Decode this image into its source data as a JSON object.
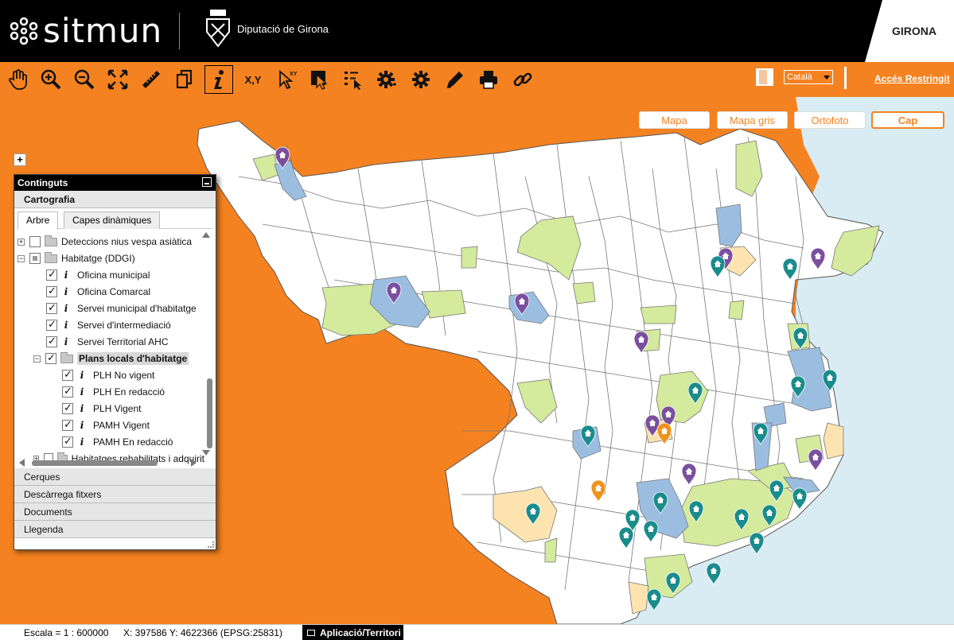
{
  "header": {
    "app_name": "sitmun",
    "org_name": "Diputació de Girona",
    "region": "GIRONA"
  },
  "toolbar": {
    "tools": [
      {
        "name": "pan-tool",
        "icon": "hand-icon"
      },
      {
        "name": "zoom-in-tool",
        "icon": "zoom-in-icon"
      },
      {
        "name": "zoom-out-tool",
        "icon": "zoom-out-icon"
      },
      {
        "name": "full-extent-tool",
        "icon": "expand-icon"
      },
      {
        "name": "measure-tool",
        "icon": "ruler-icon"
      },
      {
        "name": "copy-tool",
        "icon": "copy-icon"
      },
      {
        "name": "info-tool",
        "icon": "info-icon",
        "active": true
      },
      {
        "name": "xy-tool",
        "icon": "xy-icon",
        "label": "X,Y"
      },
      {
        "name": "locate-xy-tool",
        "icon": "cursor-xy-icon"
      },
      {
        "name": "select-tool",
        "icon": "select-icon"
      },
      {
        "name": "select-list-tool",
        "icon": "list-select-icon"
      },
      {
        "name": "settings-tool",
        "icon": "gear-icon"
      },
      {
        "name": "advanced-settings-tool",
        "icon": "gear-plus-icon"
      },
      {
        "name": "edit-tool",
        "icon": "pencil-icon"
      },
      {
        "name": "print-tool",
        "icon": "printer-icon"
      },
      {
        "name": "link-tool",
        "icon": "link-icon"
      }
    ],
    "language": "Català",
    "restricted_access": "Accés Restringit"
  },
  "base_layers": [
    {
      "label": "Mapa",
      "active": false
    },
    {
      "label": "Mapa gris",
      "active": false
    },
    {
      "label": "Ortofoto",
      "active": false
    },
    {
      "label": "Cap",
      "active": true
    }
  ],
  "zoom": {
    "plus": "+"
  },
  "panel": {
    "title": "Continguts",
    "section_cartography": "Cartografia",
    "tabs": [
      "Arbre",
      "Capes dinàmiques"
    ],
    "tree": [
      {
        "label": "Deteccions nius vespa asiàtica",
        "type": "folder",
        "level": 0,
        "expander": "+",
        "checked": false
      },
      {
        "label": "Habitatge (DDGI)",
        "type": "folder",
        "level": 0,
        "expander": "−",
        "checked": "partial"
      },
      {
        "label": "Oficina municipal",
        "type": "layer",
        "level": 1,
        "checked": true
      },
      {
        "label": "Oficina Comarcal",
        "type": "layer",
        "level": 1,
        "checked": true
      },
      {
        "label": "Servei municipal d'habitatge",
        "type": "layer",
        "level": 1,
        "checked": true
      },
      {
        "label": "Servei d'intermediació",
        "type": "layer",
        "level": 1,
        "checked": true
      },
      {
        "label": "Servei Territorial AHC",
        "type": "layer",
        "level": 1,
        "checked": true
      },
      {
        "label": "Plans locals d'habitatge",
        "type": "folder",
        "level": 1,
        "expander": "−",
        "checked": true,
        "selected": true
      },
      {
        "label": "PLH No vigent",
        "type": "layer",
        "level": 2,
        "checked": true
      },
      {
        "label": "PLH En redacció",
        "type": "layer",
        "level": 2,
        "checked": true
      },
      {
        "label": "PLH Vigent",
        "type": "layer",
        "level": 2,
        "checked": true
      },
      {
        "label": "PAMH Vigent",
        "type": "layer",
        "level": 2,
        "checked": true
      },
      {
        "label": "PAMH En redacció",
        "type": "layer",
        "level": 2,
        "checked": true
      },
      {
        "label": "Habitatges rehabilitats i adquirit",
        "type": "folder",
        "level": 0,
        "expander": "+",
        "checked": false
      }
    ],
    "sections": [
      "Cerques",
      "Descàrrega fitxers",
      "Documents",
      "Llegenda"
    ]
  },
  "status": {
    "scale": "Escala = 1 : 600000",
    "coords": "X: 397586 Y: 4622366 (EPSG:25831)",
    "app_territory": "Aplicació/Territori"
  },
  "colors": {
    "brand_orange": "#f58220",
    "sea": "#d9ecf3",
    "land": "#ffffff",
    "plh_vigent": "#d4ea9c",
    "plh_no_vigent": "#9bbee0",
    "plh_redaccio": "#fde3b0",
    "marker_purple": "#7b4fa0",
    "marker_teal": "#1a8c8c",
    "marker_orange": "#f0921e"
  },
  "map_markers": [
    {
      "color": "purple"
    },
    {
      "color": "purple"
    },
    {
      "color": "purple"
    },
    {
      "color": "purple"
    },
    {
      "color": "purple"
    },
    {
      "color": "purple"
    },
    {
      "color": "purple"
    },
    {
      "color": "purple"
    },
    {
      "color": "purple"
    },
    {
      "color": "teal"
    },
    {
      "color": "teal"
    },
    {
      "color": "teal"
    },
    {
      "color": "teal"
    },
    {
      "color": "teal"
    },
    {
      "color": "teal"
    },
    {
      "color": "teal"
    },
    {
      "color": "teal"
    },
    {
      "color": "teal"
    },
    {
      "color": "teal"
    },
    {
      "color": "teal"
    },
    {
      "color": "teal"
    },
    {
      "color": "teal"
    },
    {
      "color": "teal"
    },
    {
      "color": "teal"
    },
    {
      "color": "teal"
    },
    {
      "color": "teal"
    },
    {
      "color": "teal"
    },
    {
      "color": "teal"
    },
    {
      "color": "orange"
    },
    {
      "color": "orange"
    }
  ]
}
